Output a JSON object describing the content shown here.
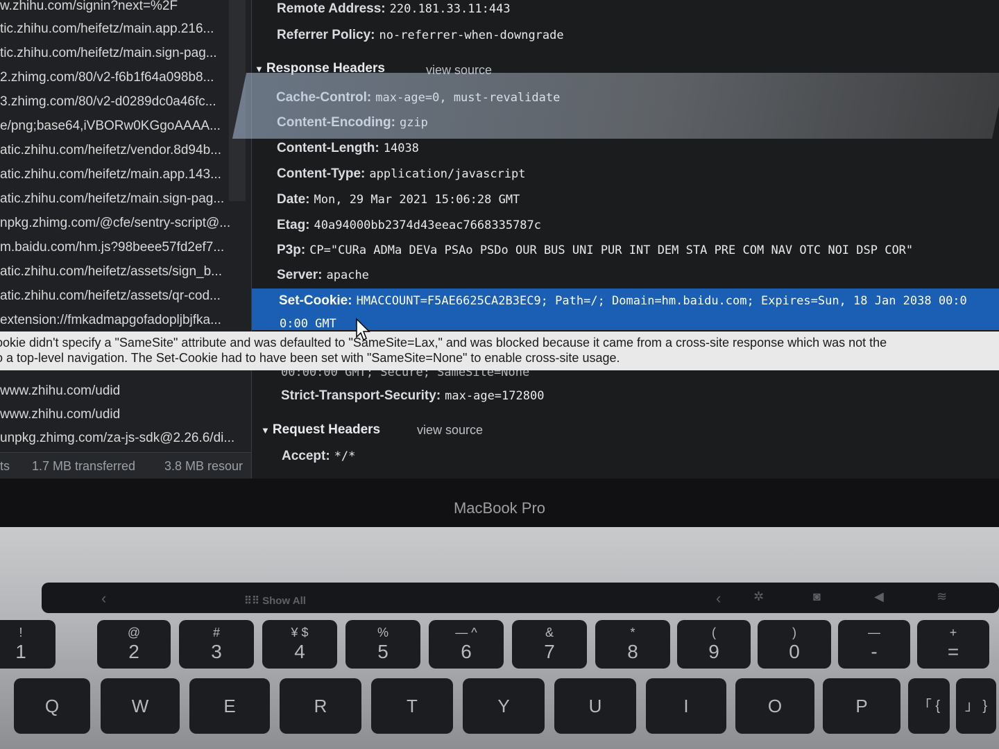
{
  "request_list": {
    "items": [
      "w.zhihu.com/signin?next=%2F",
      "tic.zhihu.com/heifetz/main.app.216...",
      "tic.zhihu.com/heifetz/main.sign-pag...",
      "2.zhimg.com/80/v2-f6b1f64a098b8...",
      "3.zhimg.com/80/v2-d0289dc0a46fc...",
      "e/png;base64,iVBORw0KGgoAAAA...",
      "atic.zhihu.com/heifetz/vendor.8d94b...",
      "atic.zhihu.com/heifetz/main.app.143...",
      "atic.zhihu.com/heifetz/main.sign-pag...",
      "npkg.zhimg.com/@cfe/sentry-script@...",
      "m.baidu.com/hm.js?98beee57fd2ef7...",
      "atic.zhihu.com/heifetz/assets/sign_b...",
      "atic.zhihu.com/heifetz/assets/qr-cod...",
      "extension://fmkadmapgofadopljbjfka...",
      "www.zhihu.com/udid",
      "www.zhihu.com/udid",
      "unpkg.zhimg.com/za-js-sdk@2.26.6/di..."
    ],
    "status": {
      "requests": "ts",
      "transferred": "1.7 MB transferred",
      "resources": "3.8 MB resour"
    }
  },
  "general": {
    "remote_address": {
      "key": "Remote Address:",
      "value": "220.181.33.11:443"
    },
    "referrer_policy": {
      "key": "Referrer Policy:",
      "value": "no-referrer-when-downgrade"
    }
  },
  "response_headers": {
    "title": "Response Headers",
    "view_source": "view source",
    "rows": [
      {
        "key": "Cache-Control:",
        "value": "max-age=0, must-revalidate"
      },
      {
        "key": "Content-Encoding:",
        "value": "gzip"
      },
      {
        "key": "Content-Length:",
        "value": "14038"
      },
      {
        "key": "Content-Type:",
        "value": "application/javascript"
      },
      {
        "key": "Date:",
        "value": "Mon, 29 Mar 2021 15:06:28 GMT"
      },
      {
        "key": "Etag:",
        "value": "40a94000bb2374d43eeac7668335787c"
      },
      {
        "key": "P3p:",
        "value": "CP=\"CURa ADMa DEVa PSAo PSDo OUR BUS UNI PUR INT DEM STA PRE COM NAV OTC NOI DSP COR\""
      },
      {
        "key": "Server:",
        "value": "apache"
      }
    ],
    "set_cookie": {
      "key": "Set-Cookie:",
      "value_line1": "HMACCOUNT=F5AE6625CA2B3EC9; Path=/; Domain=hm.baidu.com; Expires=Sun, 18 Jan 2038 00:0",
      "value_line2": "0:00 GMT",
      "value_line3": "00:00:00 GMT; Secure; SameSite=None"
    },
    "sts": {
      "key": "Strict-Transport-Security:",
      "value": "max-age=172800"
    }
  },
  "tooltip": {
    "line1": "ookie didn't specify a \"SameSite\" attribute and was defaulted to \"SameSite=Lax,\" and was blocked because it came from a cross-site response which was not the",
    "line2": "o a top-level navigation. The Set-Cookie had to have been set with \"SameSite=None\" to enable cross-site usage."
  },
  "request_headers": {
    "title": "Request Headers",
    "view_source": "view source",
    "accept": {
      "key": "Accept:",
      "value": "*/*"
    }
  },
  "laptop": {
    "brand": "MacBook Pro",
    "touchbar_label": "Show All",
    "number_keys": [
      {
        "top": "!",
        "bottom": "1"
      },
      {
        "top": "@",
        "bottom": "2"
      },
      {
        "top": "#",
        "bottom": "3"
      },
      {
        "top": "¥ $",
        "bottom": "4"
      },
      {
        "top": "%",
        "bottom": "5"
      },
      {
        "top": "— ^",
        "bottom": "6"
      },
      {
        "top": "&",
        "bottom": "7"
      },
      {
        "top": "*",
        "bottom": "8"
      },
      {
        "top": "(",
        "bottom": "9"
      },
      {
        "top": ")",
        "bottom": "0"
      },
      {
        "top": "—",
        "bottom": "-"
      },
      {
        "top": "+",
        "bottom": "="
      }
    ],
    "letter_keys": [
      "Q",
      "W",
      "E",
      "R",
      "T",
      "Y",
      "U",
      "I",
      "O",
      "P",
      "「 {",
      "」 }"
    ]
  }
}
